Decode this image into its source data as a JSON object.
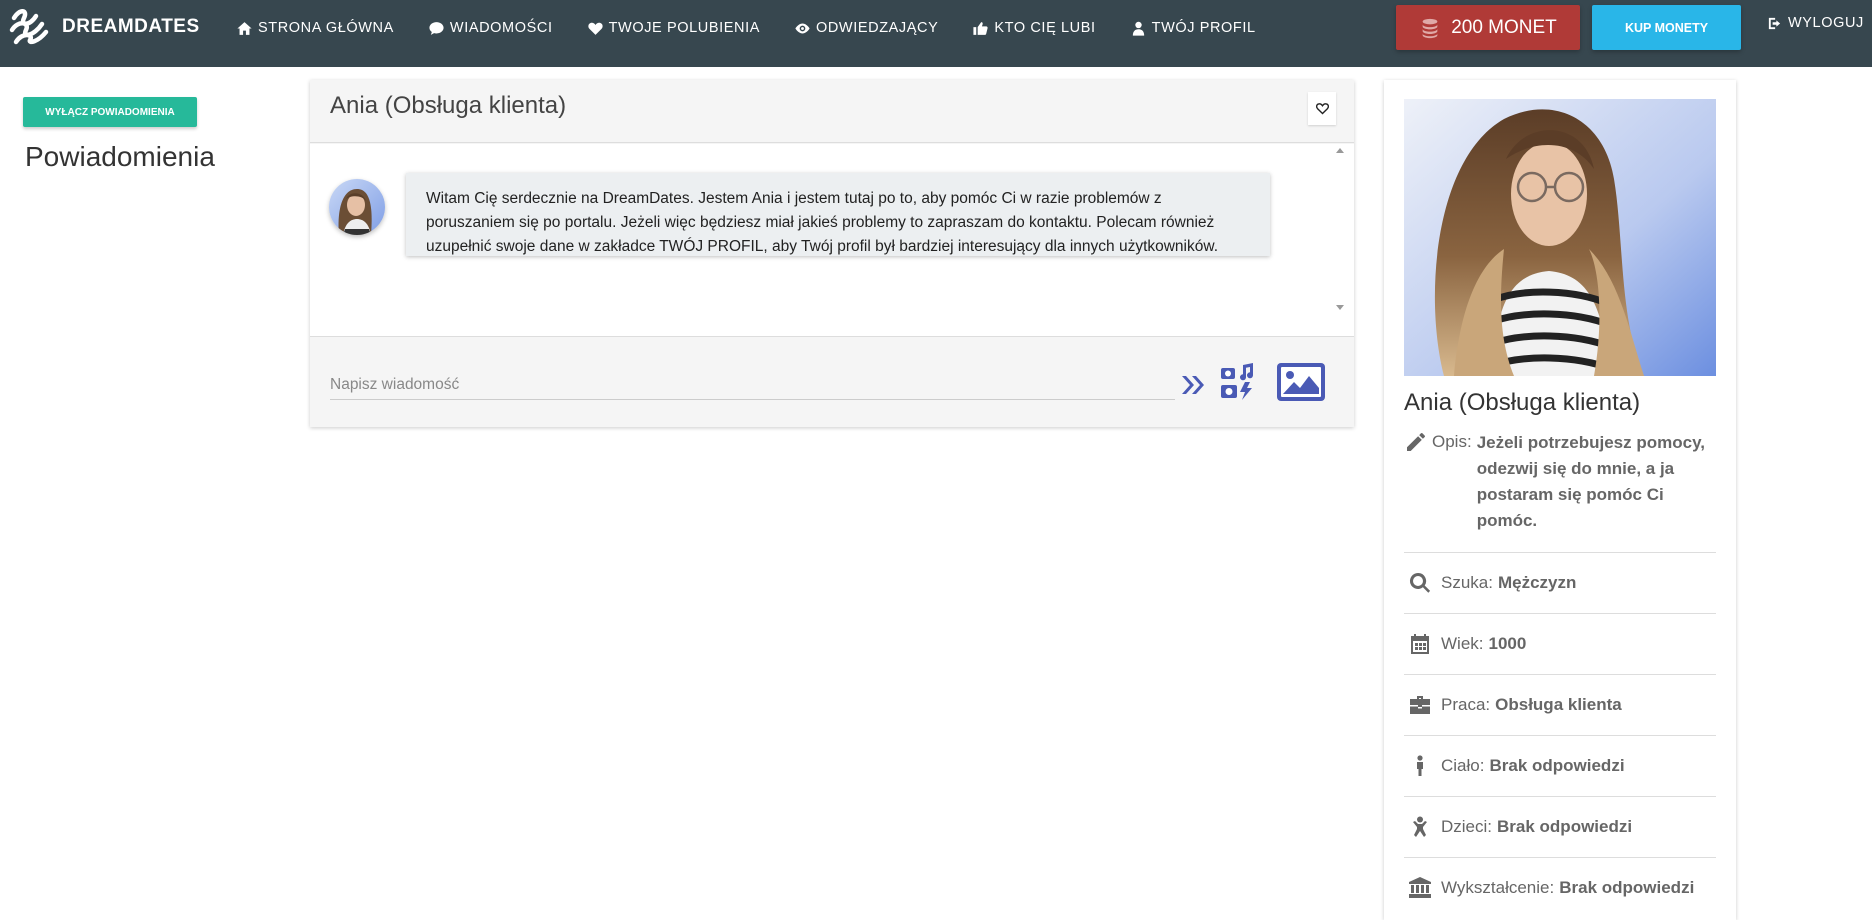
{
  "brand": {
    "name": "DREAMDATES"
  },
  "nav": {
    "items": [
      {
        "label": "STRONA GŁÓWNA",
        "icon": "home-icon"
      },
      {
        "label": "WIADOMOŚCI",
        "icon": "chat-icon"
      },
      {
        "label": "TWOJE POLUBIENIA",
        "icon": "heart-icon"
      },
      {
        "label": "ODWIEDZAJĄCY",
        "icon": "eye-icon"
      },
      {
        "label": "KTO CIĘ LUBI",
        "icon": "thumbs-up-icon"
      },
      {
        "label": "TWÓJ PROFIL",
        "icon": "user-icon"
      }
    ],
    "coins_label": "200 MONET",
    "buy_label": "KUP MONETY",
    "logout_label": "WYLOGUJ"
  },
  "left": {
    "toggle_label": "WYŁĄCZ POWIADOMIENIA",
    "title": "Powiadomienia"
  },
  "chat": {
    "title": "Ania (Obsługa klienta)",
    "messages": [
      {
        "text": "Witam Cię serdecznie na DreamDates. Jestem Ania i jestem tutaj po to, aby pomóc Ci w razie problemów z poruszaniem się po portalu. Jeżeli więc będziesz miał jakieś problemy to zapraszam do kontaktu. Polecam również uzupełnić swoje dane w zakładce TWÓJ PROFIL, aby Twój profil był bardziej interesujący dla innych użytkowników."
      }
    ],
    "input_placeholder": "Napisz wiadomość",
    "input_value": ""
  },
  "profile": {
    "name": "Ania (Obsługa klienta)",
    "description_label": "Opis:",
    "description_value": "Jeżeli potrzebujesz pomocy, odezwij się do mnie, a ja postaram się pomóc Ci pomóc.",
    "attributes": [
      {
        "label": "Szuka:",
        "value": "Mężczyzn",
        "icon": "search-icon"
      },
      {
        "label": "Wiek:",
        "value": "1000",
        "icon": "calendar-icon"
      },
      {
        "label": "Praca:",
        "value": "Obsługa klienta",
        "icon": "briefcase-icon"
      },
      {
        "label": "Ciało:",
        "value": "Brak odpowiedzi",
        "icon": "person-icon"
      },
      {
        "label": "Dzieci:",
        "value": "Brak odpowiedzi",
        "icon": "child-icon"
      },
      {
        "label": "Wykształcenie:",
        "value": "Brak odpowiedzi",
        "icon": "university-icon"
      }
    ]
  },
  "colors": {
    "navbar": "#37474f",
    "coins": "#b03a37",
    "buy": "#29b6e8",
    "toggle": "#26b99a",
    "action_icons": "#4a5ab5"
  }
}
